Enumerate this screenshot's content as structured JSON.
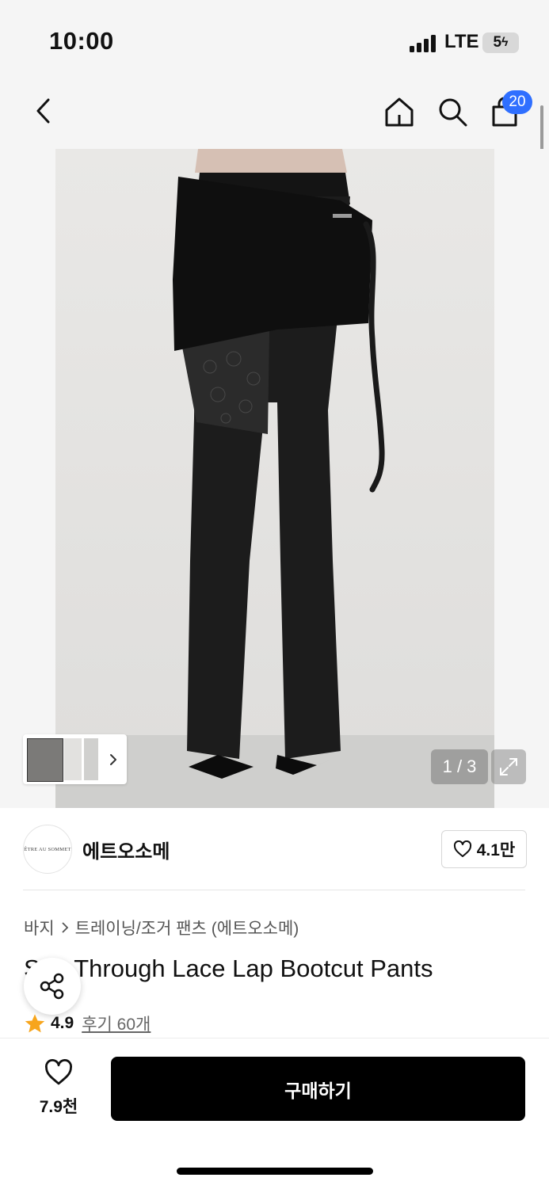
{
  "status_bar": {
    "time": "10:00",
    "network": "LTE",
    "battery": "5"
  },
  "nav": {
    "back_icon": "chevron-left-icon",
    "home_icon": "home-icon",
    "search_icon": "search-icon",
    "cart_icon": "shopping-bag-icon",
    "cart_count": "20"
  },
  "gallery": {
    "counter": "1 / 3",
    "current": 1,
    "total": 3
  },
  "brand": {
    "logo_text": "ÊTRE AU SOMMET",
    "name": "에트오소메",
    "likes": "4.1만"
  },
  "breadcrumb": {
    "category": "바지",
    "subcategory": "트레이닝/조거 팬츠 (에트오소메)"
  },
  "product": {
    "title": "See Through Lace Lap Bootcut Pants",
    "rating": "4.9",
    "reviews": "후기 60개"
  },
  "bottom": {
    "wish_count": "7.9천",
    "buy_label": "구매하기"
  },
  "colors": {
    "accent": "#2f6fff",
    "star": "#f7a51c",
    "button": "#000000"
  }
}
